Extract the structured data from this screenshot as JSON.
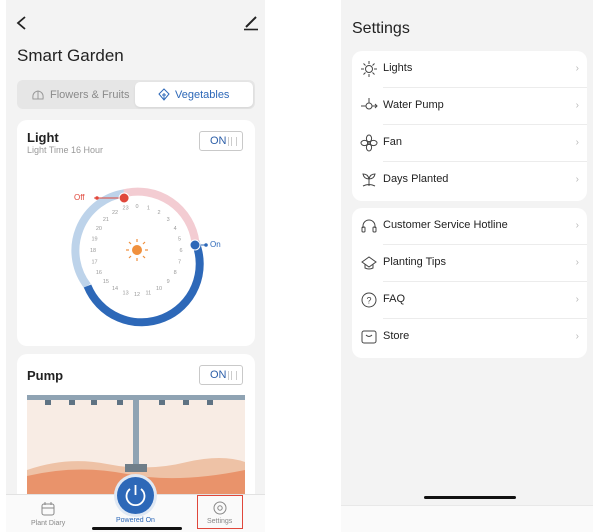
{
  "left": {
    "title": "Smart Garden",
    "tabs": [
      {
        "label": "Flowers & Fruits",
        "active": false
      },
      {
        "label": "Vegetables",
        "active": true
      }
    ],
    "light_card": {
      "title": "Light",
      "subtitle": "Light Time 16 Hour",
      "toggle": "ON",
      "off_label": "Off",
      "on_label": "On",
      "hours": [
        "22",
        "23",
        "0",
        "1",
        "2",
        "3",
        "4",
        "5",
        "6",
        "7",
        "8",
        "9",
        "10",
        "11",
        "12",
        "13",
        "14",
        "15",
        "16",
        "17",
        "18",
        "19",
        "20",
        "21"
      ]
    },
    "pump_card": {
      "title": "Pump",
      "toggle": "ON"
    },
    "bottom_nav": {
      "items": [
        {
          "label": "Plant Diary",
          "icon": "calendar-icon"
        },
        {
          "label": "Powered On",
          "icon": "power-icon"
        },
        {
          "label": "Settings",
          "icon": "settings-icon"
        }
      ]
    },
    "colors": {
      "accent": "#2d68b8",
      "highlight_box": "#e0473b",
      "light_arc": "#bdd3ea",
      "dark_arc": "#2d68b8",
      "pink_arc": "#f3ccd2",
      "sun": "#f0903d"
    }
  },
  "right": {
    "title": "Settings",
    "group1": [
      {
        "label": "Lights",
        "icon": "light-icon"
      },
      {
        "label": "Water Pump",
        "icon": "water-pump-icon"
      },
      {
        "label": "Fan",
        "icon": "fan-icon"
      },
      {
        "label": "Days Planted",
        "icon": "sprout-icon"
      }
    ],
    "group2": [
      {
        "label": "Customer Service Hotline",
        "icon": "headset-icon"
      },
      {
        "label": "Planting Tips",
        "icon": "tips-icon"
      },
      {
        "label": "FAQ",
        "icon": "faq-icon"
      },
      {
        "label": "Store",
        "icon": "store-icon"
      }
    ],
    "chevron": "›"
  }
}
